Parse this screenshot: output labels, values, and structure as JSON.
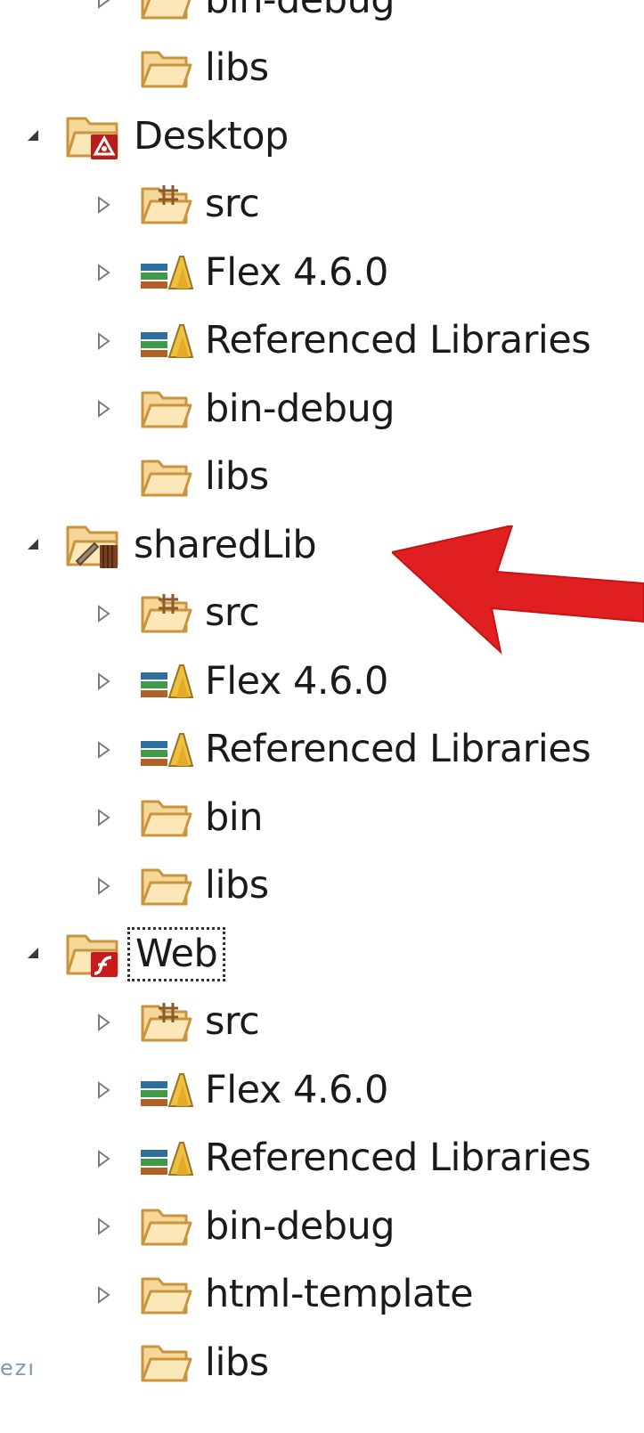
{
  "tree": [
    {
      "level": 1,
      "twisty": "collapsed",
      "icon": "folder-icon",
      "label": "bin-debug"
    },
    {
      "level": 1,
      "twisty": "none",
      "icon": "folder-icon",
      "label": "libs"
    },
    {
      "level": 0,
      "twisty": "expanded",
      "icon": "air-project-icon",
      "label": "Desktop"
    },
    {
      "level": 1,
      "twisty": "collapsed",
      "icon": "source-folder-icon",
      "label": "src"
    },
    {
      "level": 1,
      "twisty": "collapsed",
      "icon": "library-icon",
      "label": "Flex 4.6.0"
    },
    {
      "level": 1,
      "twisty": "collapsed",
      "icon": "library-icon",
      "label": "Referenced Libraries"
    },
    {
      "level": 1,
      "twisty": "collapsed",
      "icon": "folder-icon",
      "label": "bin-debug"
    },
    {
      "level": 1,
      "twisty": "none",
      "icon": "folder-icon",
      "label": "libs"
    },
    {
      "level": 0,
      "twisty": "expanded",
      "icon": "library-project-icon",
      "label": "sharedLib"
    },
    {
      "level": 1,
      "twisty": "collapsed",
      "icon": "source-folder-icon",
      "label": "src"
    },
    {
      "level": 1,
      "twisty": "collapsed",
      "icon": "library-icon",
      "label": "Flex 4.6.0"
    },
    {
      "level": 1,
      "twisty": "collapsed",
      "icon": "library-icon",
      "label": "Referenced Libraries"
    },
    {
      "level": 1,
      "twisty": "collapsed",
      "icon": "folder-icon",
      "label": "bin"
    },
    {
      "level": 1,
      "twisty": "collapsed",
      "icon": "folder-icon",
      "label": "libs"
    },
    {
      "level": 0,
      "twisty": "expanded",
      "icon": "flex-project-icon",
      "label": "Web",
      "focused": true
    },
    {
      "level": 1,
      "twisty": "collapsed",
      "icon": "source-folder-icon",
      "label": "src"
    },
    {
      "level": 1,
      "twisty": "collapsed",
      "icon": "library-icon",
      "label": "Flex 4.6.0"
    },
    {
      "level": 1,
      "twisty": "collapsed",
      "icon": "library-icon",
      "label": "Referenced Libraries"
    },
    {
      "level": 1,
      "twisty": "collapsed",
      "icon": "folder-icon",
      "label": "bin-debug"
    },
    {
      "level": 1,
      "twisty": "collapsed",
      "icon": "folder-icon",
      "label": "html-template"
    },
    {
      "level": 1,
      "twisty": "none",
      "icon": "folder-icon",
      "label": "libs"
    }
  ],
  "annotation": {
    "icon": "red-arrow-icon",
    "color": "#e02020",
    "points_to": "sharedLib"
  },
  "watermark": "ezı",
  "colors": {
    "folder_fill": "#f6d79a",
    "folder_stroke": "#c8953e",
    "twisty": "#7d7d7d",
    "air_badge": "#b81d1d",
    "flex_badge": "#c8191b",
    "arrow": "#e02020"
  }
}
